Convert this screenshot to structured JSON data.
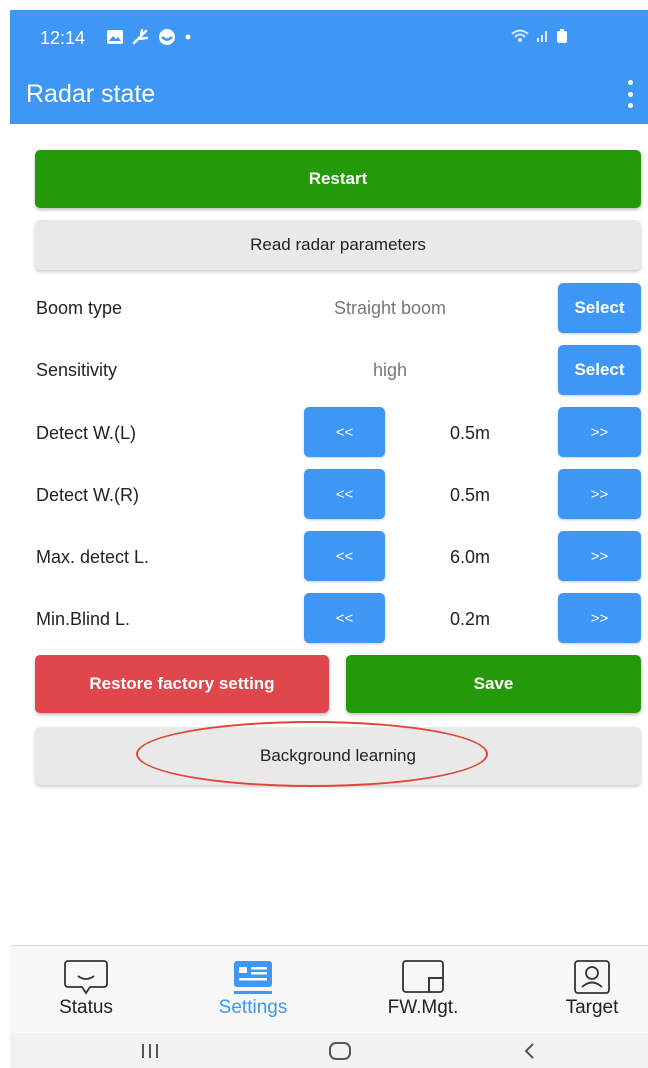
{
  "status_bar": {
    "time": "12:14"
  },
  "app_bar": {
    "title": "Radar state"
  },
  "actions": {
    "restart": "Restart",
    "read_params": "Read radar parameters",
    "restore_factory": "Restore factory setting",
    "save": "Save",
    "background_learning": "Background learning"
  },
  "settings": {
    "boom_type": {
      "label": "Boom type",
      "value": "Straight boom",
      "button": "Select"
    },
    "sensitivity": {
      "label": "Sensitivity",
      "value": "high",
      "button": "Select"
    },
    "detect_w_left": {
      "label": "Detect W.(L)",
      "value": "0.5m",
      "dec": "<<",
      "inc": ">>"
    },
    "detect_w_right": {
      "label": "Detect W.(R)",
      "value": "0.5m",
      "dec": "<<",
      "inc": ">>"
    },
    "max_detect_l": {
      "label": "Max. detect L.",
      "value": "6.0m",
      "dec": "<<",
      "inc": ">>"
    },
    "min_blind_l": {
      "label": "Min.Blind L.",
      "value": "0.2m",
      "dec": "<<",
      "inc": ">>"
    }
  },
  "bottom_nav": {
    "items": [
      {
        "label": "Status",
        "icon": "status-icon"
      },
      {
        "label": "Settings",
        "icon": "settings-icon",
        "active": true
      },
      {
        "label": "FW.Mgt.",
        "icon": "firmware-icon"
      },
      {
        "label": "Target",
        "icon": "target-icon"
      }
    ]
  },
  "colors": {
    "primary_blue": "#3f97f5",
    "green": "#249a0a",
    "red": "#e0474c",
    "gray_button": "#e9e9e9",
    "annotation_red": "#e0473a"
  }
}
